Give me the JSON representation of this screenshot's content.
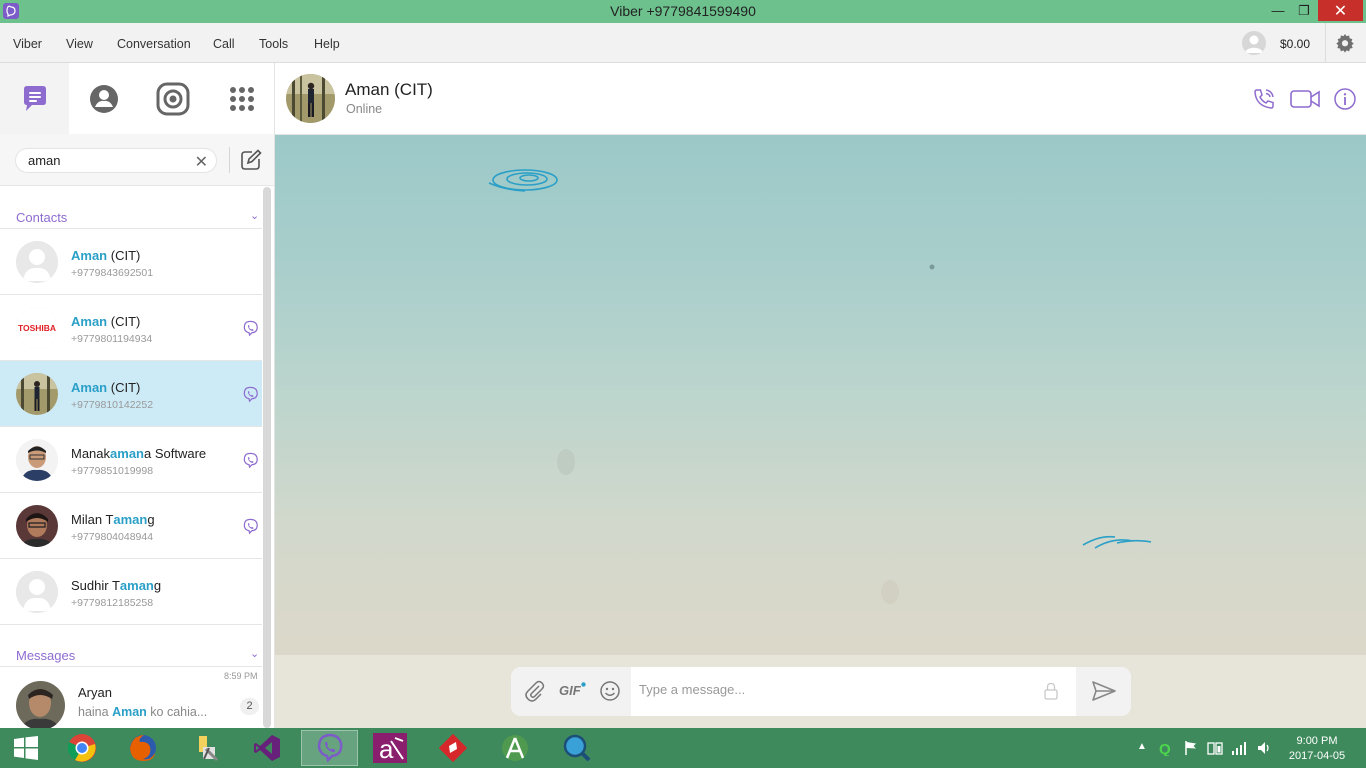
{
  "window": {
    "title": "Viber +9779841599490",
    "minimize": "—",
    "restore": "❐",
    "close": "✕"
  },
  "menu": {
    "items": [
      "Viber",
      "View",
      "Conversation",
      "Call",
      "Tools",
      "Help"
    ],
    "balance": "$0.00"
  },
  "sidebar": {
    "tabs": [
      {
        "name": "chats-tab-icon",
        "active": true
      },
      {
        "name": "contacts-tab-icon",
        "active": false
      },
      {
        "name": "public-chats-tab-icon",
        "active": false
      },
      {
        "name": "dialpad-tab-icon",
        "active": false
      }
    ],
    "search": {
      "value": "aman",
      "clear": "✕"
    },
    "contacts_header": "Contacts",
    "contacts": [
      {
        "pre": "",
        "hl": "Aman",
        "post": " (CIT)",
        "phone": "+9779843692501",
        "viber": false,
        "selected": false
      },
      {
        "pre": "",
        "hl": "Aman",
        "post": " (CIT)",
        "phone": "+9779801194934",
        "viber": true,
        "selected": false
      },
      {
        "pre": "",
        "hl": "Aman",
        "post": " (CIT)",
        "phone": "+9779810142252",
        "viber": true,
        "selected": true
      },
      {
        "pre": "Manak",
        "hl": "aman",
        "post": "a Software",
        "phone": "+9779851019998",
        "viber": true,
        "selected": false
      },
      {
        "pre": "Milan T",
        "hl": "aman",
        "post": "g",
        "phone": "+9779804048944",
        "viber": true,
        "selected": false
      },
      {
        "pre": "Sudhir T",
        "hl": "aman",
        "post": "g",
        "phone": "+9779812185258",
        "viber": false,
        "selected": false
      }
    ],
    "toshiba_logo": "TOSHIBA",
    "messages_header": "Messages",
    "messages": [
      {
        "name": "Aryan",
        "preview_pre": "haina ",
        "preview_hl": "Aman",
        "preview_post": " ko cahia...",
        "time": "8:59 PM",
        "unread": "2"
      }
    ]
  },
  "chat": {
    "name": "Aman (CIT)",
    "status": "Online"
  },
  "composer": {
    "gif": "GIF",
    "placeholder": "Type a message..."
  },
  "taskbar": {
    "clock_time": "9:00 PM",
    "clock_date": "2017-04-05"
  },
  "colors": {
    "titlebar": "#6cc18d",
    "viber_purple": "#8e6ccf",
    "highlight": "#2a9fc7",
    "selected_row": "#cdeaf7",
    "taskbar": "#3e8a5c"
  }
}
